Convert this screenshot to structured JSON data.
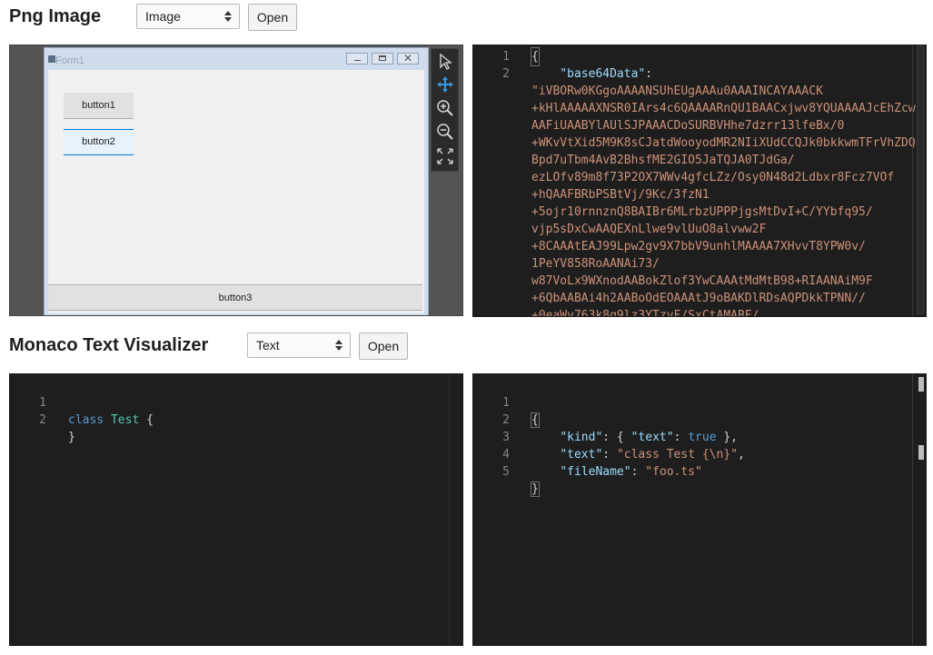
{
  "png_section": {
    "title": "Png Image",
    "select_value": "Image",
    "open_label": "Open",
    "image": {
      "form_title": "Form1",
      "button1": "button1",
      "button2": "button2",
      "button3": "button3"
    },
    "toolbar_icons": [
      "select-pointer-icon",
      "pan-icon",
      "zoom-in-icon",
      "zoom-out-icon",
      "fit-icon"
    ],
    "json_lines": [
      {
        "n": "1",
        "text": "{"
      },
      {
        "n": "2",
        "text": "    \"base64Data\":"
      },
      {
        "n": "",
        "text": "\"iVBORw0KGgoAAAANSUhEUgAAAu0AAAINCAYAAACK"
      },
      {
        "n": "",
        "text": "+kHlAAAAAXNSR0IArs4c6QAAAARnQU1BAACxjwv8YQUAAAAJcEhZcw"
      },
      {
        "n": "",
        "text": "AAFiUAABYlAUlSJPAAACDoSURBVHhe7dzrr13lfeBx/0"
      },
      {
        "n": "",
        "text": "+WKvVtXid5M9K8sCJatdWooyodMR2NIiXUdCCQJk0bkkwmTFrVhZDQ"
      },
      {
        "n": "",
        "text": "Bpd7uTbm4AvB2BhsfME2GIO5JaTQJA0TJdGa/"
      },
      {
        "n": "",
        "text": "ezLOfv89m8f73P2OX7WWv4gfcLZz/Osy0N48d2Ldbxr8Fcz7VOf"
      },
      {
        "n": "",
        "text": "+hQAAFBRbPSBtVj/9Kc/3fzN1"
      },
      {
        "n": "",
        "text": "+5ojr10rnnznQ8BAIBr6MLrbzUPPPjgsMtDvI+C/YYbfq95/"
      },
      {
        "n": "",
        "text": "vjp5sDxCwAAQEXnLlwe9vlUuO8alvww2F"
      },
      {
        "n": "",
        "text": "+8CAAAtEAJ99Lpw2gv9X7bbV9unhlMAAAA7XHvvT8YPW0v/"
      },
      {
        "n": "",
        "text": "1PeYV858RoAANAi73/"
      },
      {
        "n": "",
        "text": "w87VoLx9WXnodAABokZlof3YwCAAAtMdMtB98+RIAANAiM9F"
      },
      {
        "n": "",
        "text": "+6QbAABAi4h2AABoOdEOAAAtJ9oBAKDlRDsAQPDkkTPNN//"
      },
      {
        "n": "",
        "text": "+0eaWv763k8q9lz3YTzvF/SxCtAMABF/"
      }
    ]
  },
  "monaco_section": {
    "title": "Monaco Text Visualizer",
    "select_value": "Text",
    "open_label": "Open",
    "editor_lines": [
      {
        "n": "1"
      },
      {
        "n": "2"
      }
    ],
    "editor_tokens": {
      "kw": "class",
      "type": "Test",
      "open": "{",
      "close": "}"
    },
    "json_line_numbers": [
      "1",
      "2",
      "3",
      "4",
      "5"
    ],
    "json_tokens": {
      "open": "{",
      "kind_key": "\"kind\"",
      "kind_val_open": ": { ",
      "text_key_inner": "\"text\"",
      "colon": ": ",
      "true_val": "true",
      "kind_val_close": " },",
      "text_key": "\"text\"",
      "text_val": "\"class Test {\\n}\"",
      "comma": ",",
      "filename_key": "\"fileName\"",
      "filename_val": "\"foo.ts\"",
      "close": "}"
    }
  }
}
